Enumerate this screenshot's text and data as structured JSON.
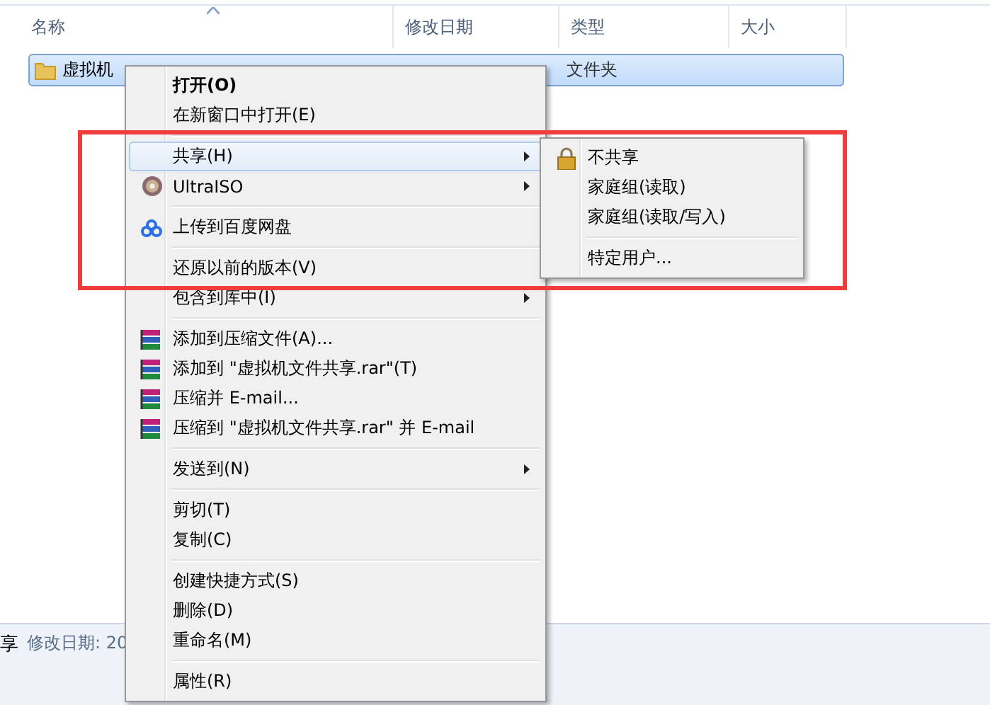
{
  "columns": [
    {
      "label": "名称",
      "sorted": true
    },
    {
      "label": "修改日期",
      "sorted": false
    },
    {
      "label": "类型",
      "sorted": false
    },
    {
      "label": "大小",
      "sorted": false
    }
  ],
  "file": {
    "name": "虚拟机",
    "type": "文件夹",
    "selected": true
  },
  "context_menu": [
    {
      "kind": "item",
      "label": "打开(O)",
      "default": true,
      "selected": false,
      "submenu": false
    },
    {
      "kind": "item",
      "label": "在新窗口中打开(E)",
      "default": false,
      "selected": false,
      "submenu": false
    },
    {
      "kind": "separator"
    },
    {
      "kind": "item",
      "label": "共享(H)",
      "default": false,
      "selected": true,
      "submenu": true
    },
    {
      "kind": "disc",
      "label": "UltraISO",
      "default": false,
      "selected": false,
      "submenu": true
    },
    {
      "kind": "separator"
    },
    {
      "kind": "cloud",
      "label": "上传到百度网盘",
      "default": false,
      "selected": false,
      "submenu": false
    },
    {
      "kind": "separator"
    },
    {
      "kind": "item",
      "label": "还原以前的版本(V)",
      "default": false,
      "selected": false,
      "submenu": false
    },
    {
      "kind": "item",
      "label": "包含到库中(I)",
      "default": false,
      "selected": false,
      "submenu": true
    },
    {
      "kind": "separator"
    },
    {
      "kind": "archive",
      "label": "添加到压缩文件(A)...",
      "default": false,
      "selected": false,
      "submenu": false
    },
    {
      "kind": "archive",
      "label": "添加到 \"虚拟机文件共享.rar\"(T)",
      "default": false,
      "selected": false,
      "submenu": false
    },
    {
      "kind": "archive",
      "label": "压缩并 E-mail...",
      "default": false,
      "selected": false,
      "submenu": false
    },
    {
      "kind": "archive",
      "label": "压缩到 \"虚拟机文件共享.rar\" 并 E-mail",
      "default": false,
      "selected": false,
      "submenu": false
    },
    {
      "kind": "separator"
    },
    {
      "kind": "item",
      "label": "发送到(N)",
      "default": false,
      "selected": false,
      "submenu": true
    },
    {
      "kind": "separator"
    },
    {
      "kind": "item",
      "label": "剪切(T)",
      "default": false,
      "selected": false,
      "submenu": false
    },
    {
      "kind": "item",
      "label": "复制(C)",
      "default": false,
      "selected": false,
      "submenu": false
    },
    {
      "kind": "separator"
    },
    {
      "kind": "item",
      "label": "创建快捷方式(S)",
      "default": false,
      "selected": false,
      "submenu": false
    },
    {
      "kind": "item",
      "label": "删除(D)",
      "default": false,
      "selected": false,
      "submenu": false
    },
    {
      "kind": "item",
      "label": "重命名(M)",
      "default": false,
      "selected": false,
      "submenu": false
    },
    {
      "kind": "separator"
    },
    {
      "kind": "item",
      "label": "属性(R)",
      "default": false,
      "selected": false,
      "submenu": false
    }
  ],
  "share_submenu": [
    {
      "kind": "lock",
      "label": "不共享"
    },
    {
      "kind": "item",
      "label": "家庭组(读取)"
    },
    {
      "kind": "item",
      "label": "家庭组(读取/写入)"
    },
    {
      "kind": "separator"
    },
    {
      "kind": "item",
      "label": "特定用户..."
    }
  ],
  "details_pane": {
    "name": "享",
    "field": "修改日期: 20"
  },
  "highlight_frame": true
}
